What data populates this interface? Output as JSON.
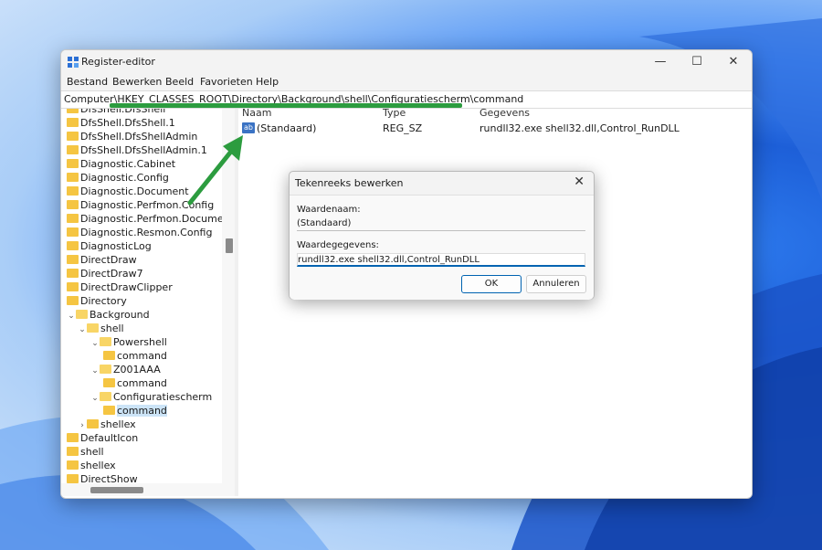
{
  "window": {
    "title": "Register-editor",
    "minimize_glyph": "—",
    "maximize_glyph": "☐",
    "close_glyph": "✕"
  },
  "menu": [
    "Bestand",
    "Bewerken",
    "Beeld",
    "Favorieten",
    "Help"
  ],
  "address": "Computer\\HKEY_CLASSES_ROOT\\Directory\\Background\\shell\\Configuratiescherm\\command",
  "tree": [
    {
      "label": "DfsShell.DfsShell",
      "depth": 0,
      "chevron": "",
      "selected": false
    },
    {
      "label": "DfsShell.DfsShell.1",
      "depth": 0,
      "chevron": "",
      "selected": false
    },
    {
      "label": "DfsShell.DfsShellAdmin",
      "depth": 0,
      "chevron": "",
      "selected": false
    },
    {
      "label": "DfsShell.DfsShellAdmin.1",
      "depth": 0,
      "chevron": "",
      "selected": false
    },
    {
      "label": "Diagnostic.Cabinet",
      "depth": 0,
      "chevron": "",
      "selected": false
    },
    {
      "label": "Diagnostic.Config",
      "depth": 0,
      "chevron": "",
      "selected": false
    },
    {
      "label": "Diagnostic.Document",
      "depth": 0,
      "chevron": "",
      "selected": false
    },
    {
      "label": "Diagnostic.Perfmon.Config",
      "depth": 0,
      "chevron": "",
      "selected": false
    },
    {
      "label": "Diagnostic.Perfmon.Document",
      "depth": 0,
      "chevron": "",
      "selected": false
    },
    {
      "label": "Diagnostic.Resmon.Config",
      "depth": 0,
      "chevron": "",
      "selected": false
    },
    {
      "label": "DiagnosticLog",
      "depth": 0,
      "chevron": "",
      "selected": false
    },
    {
      "label": "DirectDraw",
      "depth": 0,
      "chevron": "",
      "selected": false
    },
    {
      "label": "DirectDraw7",
      "depth": 0,
      "chevron": "",
      "selected": false
    },
    {
      "label": "DirectDrawClipper",
      "depth": 0,
      "chevron": "",
      "selected": false
    },
    {
      "label": "Directory",
      "depth": 0,
      "chevron": "",
      "selected": false
    },
    {
      "label": "Background",
      "depth": 0,
      "chevron": "⌄",
      "selected": false
    },
    {
      "label": "shell",
      "depth": 1,
      "chevron": "⌄",
      "selected": false
    },
    {
      "label": "Powershell",
      "depth": 2,
      "chevron": "⌄",
      "selected": false
    },
    {
      "label": "command",
      "depth": 3,
      "chevron": "",
      "selected": false
    },
    {
      "label": "Z001AAA",
      "depth": 2,
      "chevron": "⌄",
      "selected": false
    },
    {
      "label": "command",
      "depth": 3,
      "chevron": "",
      "selected": false
    },
    {
      "label": "Configuratiescherm",
      "depth": 2,
      "chevron": "⌄",
      "selected": false
    },
    {
      "label": "command",
      "depth": 3,
      "chevron": "",
      "selected": true
    },
    {
      "label": "shellex",
      "depth": 1,
      "chevron": "›",
      "selected": false
    },
    {
      "label": "DefaultIcon",
      "depth": 0,
      "chevron": "",
      "selected": false
    },
    {
      "label": "shell",
      "depth": 0,
      "chevron": "",
      "selected": false
    },
    {
      "label": "shellex",
      "depth": 0,
      "chevron": "",
      "selected": false
    },
    {
      "label": "DirectShow",
      "depth": 0,
      "chevron": "",
      "selected": false
    }
  ],
  "list": {
    "headers": {
      "name": "Naam",
      "type": "Type",
      "data": "Gegevens"
    },
    "rows": [
      {
        "icon": "ab",
        "name": "(Standaard)",
        "type": "REG_SZ",
        "data": "rundll32.exe shell32.dll,Control_RunDLL"
      }
    ]
  },
  "dialog": {
    "title": "Tekenreeks bewerken",
    "close_glyph": "✕",
    "value_name_label": "Waardenaam:",
    "value_name": "(Standaard)",
    "value_data_label": "Waardegegevens:",
    "value_data": "rundll32.exe shell32.dll,Control_RunDLL",
    "ok_label": "OK",
    "cancel_label": "Annuleren"
  },
  "colors": {
    "annotation_green": "#2c9c3f",
    "accent_blue": "#0063b1",
    "folder_yellow": "#f5c542"
  }
}
